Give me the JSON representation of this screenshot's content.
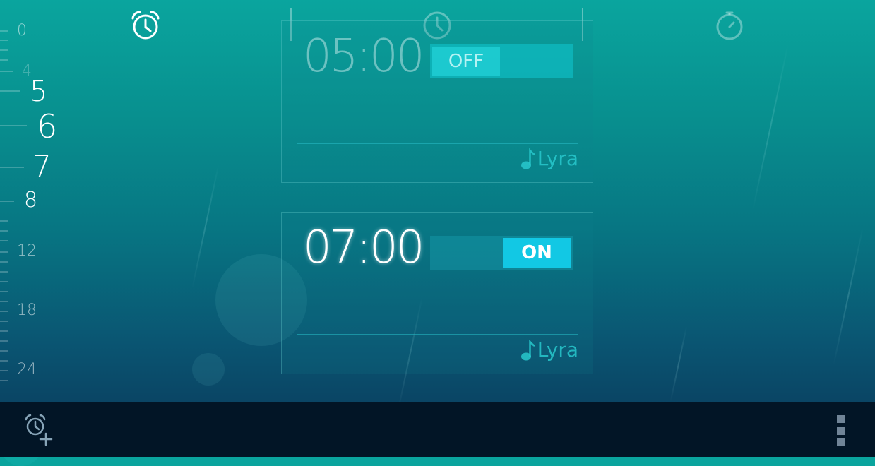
{
  "tabs": [
    {
      "icon": "alarm-clock-icon",
      "active": true
    },
    {
      "icon": "clock-icon",
      "active": false
    },
    {
      "icon": "stopwatch-icon",
      "active": false
    }
  ],
  "hour_ruler": {
    "labels": [
      "0",
      "4",
      "5",
      "6",
      "7",
      "8",
      "12",
      "18",
      "24"
    ]
  },
  "alarms": [
    {
      "time": "05:00",
      "state_label": "OFF",
      "enabled": false,
      "ringtone": "Lyra",
      "ringtone_icon": "music-note-icon"
    },
    {
      "time": "07:00",
      "state_label": "ON",
      "enabled": true,
      "ringtone": "Lyra",
      "ringtone_icon": "music-note-icon"
    }
  ],
  "bottom_bar": {
    "add_icon": "add-alarm-icon",
    "menu_icon": "overflow-menu-icon"
  },
  "colors": {
    "accent": "#12c8e4",
    "bar": "#021526",
    "bg_top": "#0aa59e",
    "bg_bottom": "#0b3658"
  }
}
